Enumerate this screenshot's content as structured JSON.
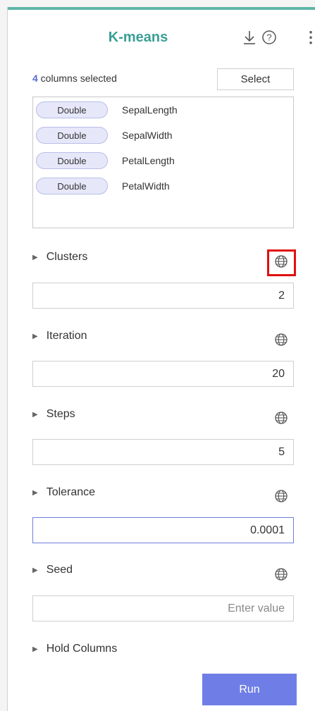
{
  "panel": {
    "title": "K-means",
    "icons": {
      "download": "download-icon",
      "help": "help-icon",
      "more": "more-vertical-icon"
    },
    "accent_color": "#3a9f95"
  },
  "columns": {
    "count": "4",
    "count_suffix": " columns selected",
    "select_label": "Select",
    "items": [
      {
        "type": "Double",
        "name": "SepalLength"
      },
      {
        "type": "Double",
        "name": "SepalWidth"
      },
      {
        "type": "Double",
        "name": "PetalLength"
      },
      {
        "type": "Double",
        "name": "PetalWidth"
      }
    ]
  },
  "params": {
    "clusters": {
      "label": "Clusters",
      "value": "2"
    },
    "iteration": {
      "label": "Iteration",
      "value": "20"
    },
    "steps": {
      "label": "Steps",
      "value": "5"
    },
    "tolerance": {
      "label": "Tolerance",
      "value": "0.0001"
    },
    "seed": {
      "label": "Seed",
      "value": "",
      "placeholder": "Enter value"
    }
  },
  "hold_columns": {
    "label": "Hold Columns"
  },
  "run_label": "Run",
  "highlight_color": "#e01010"
}
